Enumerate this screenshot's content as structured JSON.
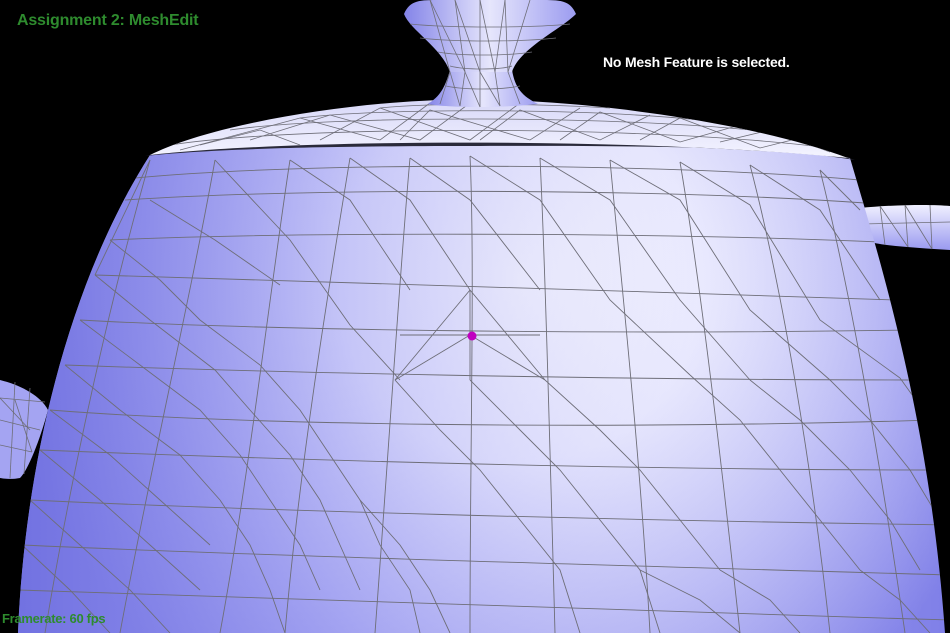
{
  "app": {
    "title": "Assignment 2: MeshEdit"
  },
  "status": {
    "selection_text": "No Mesh Feature is selected."
  },
  "footer": {
    "frame_rate_text": "Framerate: 60 fps"
  },
  "colors": {
    "background": "#000000",
    "title_text": "#2e8b2e",
    "status_text": "#ffffff",
    "framerate_text": "#2e8b2e",
    "mesh_light": "#ffffff",
    "mesh_shade": "#8c8cf0",
    "wireframe": "#6e6e78",
    "hover_vertex": "#c000c0"
  },
  "scene": {
    "model": "teapot",
    "render_mode": "shaded-wireframe",
    "hovered_vertex_icon": "magenta-dot-icon"
  }
}
